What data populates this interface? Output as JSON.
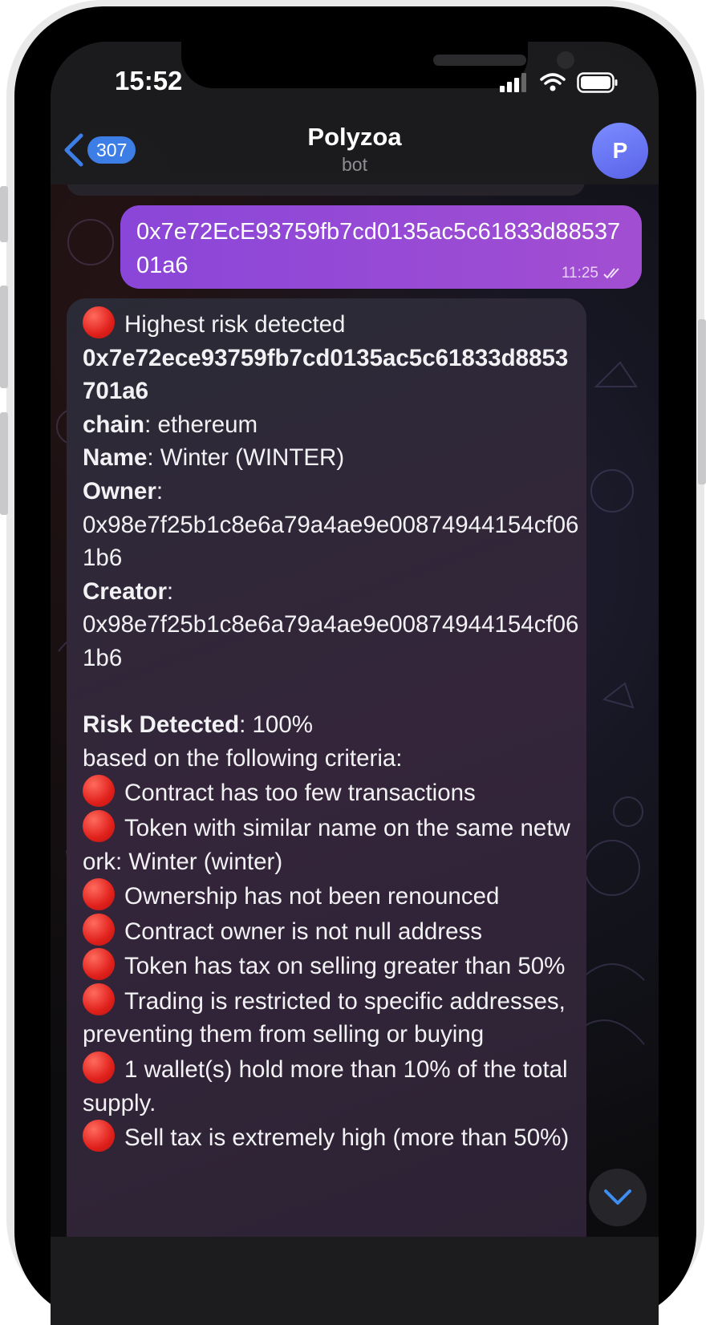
{
  "status_bar": {
    "time": "15:52"
  },
  "header": {
    "back_count": "307",
    "title": "Polyzoa",
    "subtitle": "bot",
    "avatar_letter": "P"
  },
  "outgoing": {
    "text": "0x7e72EcE93759fb7cd0135ac5c61833d8853701a6",
    "time": "11:25"
  },
  "incoming": {
    "lines": [
      {
        "dot": true,
        "bold": "",
        "text": "Highest risk detected"
      },
      {
        "dot": false,
        "bold": "0x7e72ece93759fb7cd0135ac5c61833d8853701a6",
        "text": ""
      },
      {
        "dot": false,
        "bold": "chain",
        "text": ": ethereum"
      },
      {
        "dot": false,
        "bold": "Name",
        "text": ": Winter (WINTER)"
      },
      {
        "dot": false,
        "bold": "Owner",
        "text": ":"
      },
      {
        "dot": false,
        "bold": "",
        "text": "0x98e7f25b1c8e6a79a4ae9e00874944154cf061b6"
      },
      {
        "dot": false,
        "bold": "Creator",
        "text": ":"
      },
      {
        "dot": false,
        "bold": "",
        "text": "0x98e7f25b1c8e6a79a4ae9e00874944154cf061b6"
      },
      {
        "dot": false,
        "bold": "",
        "text": ""
      },
      {
        "dot": false,
        "bold": "Risk Detected",
        "text": ": 100%"
      },
      {
        "dot": false,
        "bold": "",
        "text": "based on the following criteria:"
      },
      {
        "dot": true,
        "bold": "",
        "text": "Contract has too few transactions"
      },
      {
        "dot": true,
        "bold": "",
        "text": "Token with similar name on the same network: Winter (winter)"
      },
      {
        "dot": true,
        "bold": "",
        "text": "Ownership has not been renounced"
      },
      {
        "dot": true,
        "bold": "",
        "text": "Contract owner is not null address"
      },
      {
        "dot": true,
        "bold": "",
        "text": "Token has tax on selling greater than 50%"
      },
      {
        "dot": true,
        "bold": "",
        "text": "Trading is restricted to specific addresses, preventing them from selling or buying"
      },
      {
        "dot": true,
        "bold": "",
        "text": "1 wallet(s) hold more than 10% of the total supply."
      },
      {
        "dot": true,
        "bold": "",
        "text": "Sell tax is extremely high (more than 50%)"
      }
    ]
  },
  "colors": {
    "accent_blue": "#3d7ee6",
    "outgoing_bubble": "#9a4bd6",
    "risk_dot": "#e0201b"
  },
  "icons": {
    "back": "chevron-left-icon",
    "scroll": "chevron-down-icon",
    "wifi": "wifi-icon",
    "battery": "battery-icon",
    "signal": "signal-icon",
    "read": "double-check-icon"
  }
}
